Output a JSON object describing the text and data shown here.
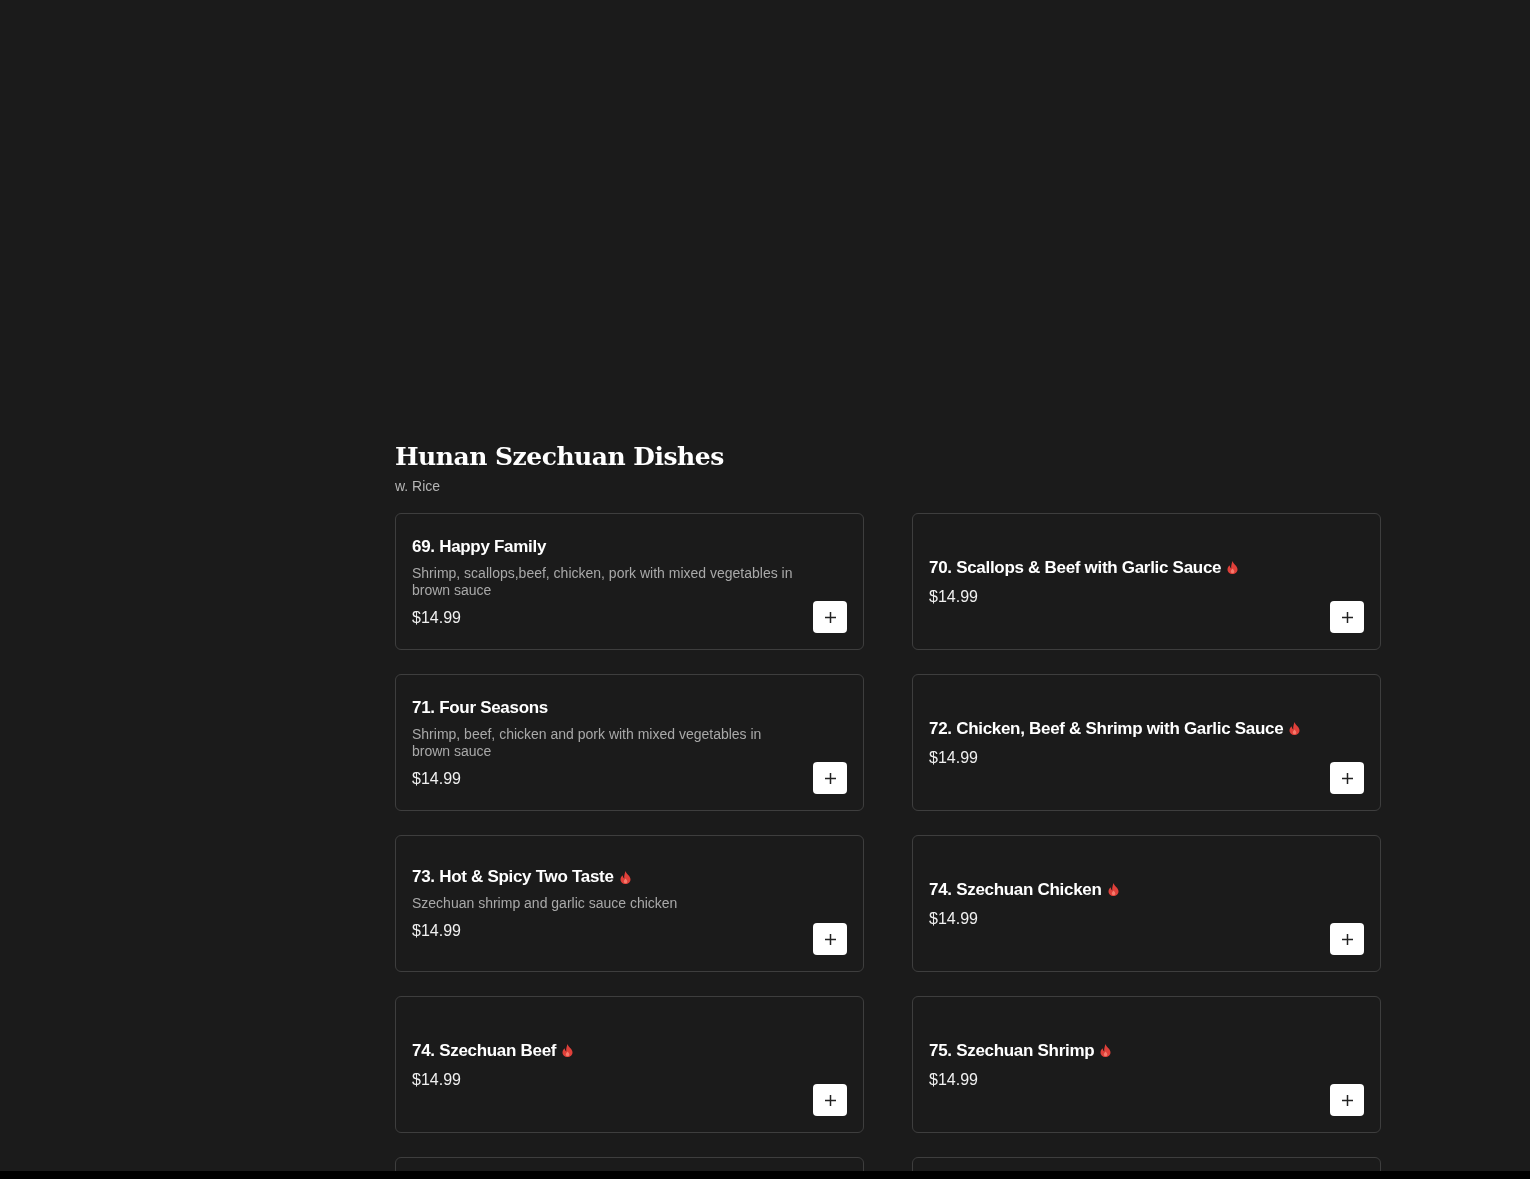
{
  "section": {
    "title": "Hunan Szechuan Dishes",
    "subtitle": "w. Rice"
  },
  "items": [
    {
      "name": "69. Happy Family",
      "description": "Shrimp, scallops,beef, chicken, pork with mixed vegetables in brown sauce",
      "price": "$14.99",
      "spicy": false
    },
    {
      "name": "70. Scallops & Beef with Garlic Sauce",
      "price": "$14.99",
      "spicy": true
    },
    {
      "name": "71. Four Seasons",
      "description": "Shrimp, beef, chicken and pork with mixed vegetables in brown sauce",
      "price": "$14.99",
      "spicy": false
    },
    {
      "name": "72. Chicken, Beef & Shrimp with Garlic Sauce",
      "price": "$14.99",
      "spicy": true
    },
    {
      "name": "73. Hot & Spicy Two Taste",
      "description": "Szechuan shrimp and garlic sauce chicken",
      "price": "$14.99",
      "spicy": true
    },
    {
      "name": "74. Szechuan Chicken",
      "price": "$14.99",
      "spicy": true
    },
    {
      "name": "74. Szechuan Beef",
      "price": "$14.99",
      "spicy": true
    },
    {
      "name": "75. Szechuan Shrimp",
      "price": "$14.99",
      "spicy": true
    }
  ]
}
